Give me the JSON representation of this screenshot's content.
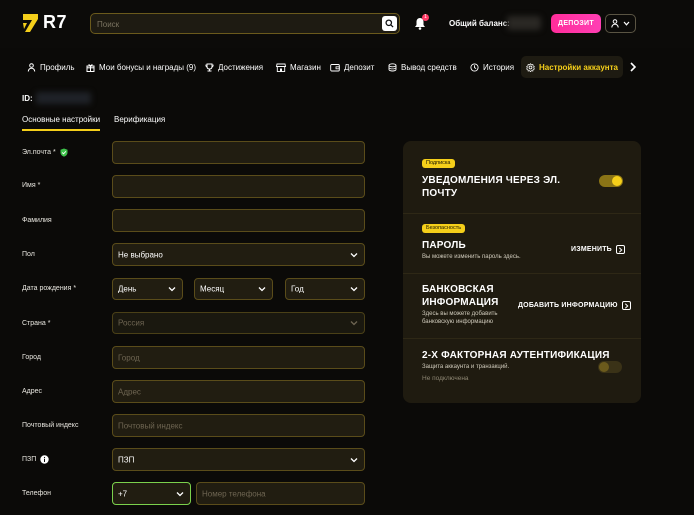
{
  "header": {
    "logo_text": "R7",
    "search_placeholder": "Поиск",
    "notification_count": "1",
    "balance_label": "Общий баланс:",
    "deposit_label": "ДЕПОЗИТ"
  },
  "nav": {
    "items": [
      {
        "label": "Профиль",
        "icon": "user-icon"
      },
      {
        "label": "Мои бонусы и награды (9)",
        "icon": "gift-icon"
      },
      {
        "label": "Достижения",
        "icon": "trophy-icon"
      },
      {
        "label": "Магазин",
        "icon": "store-icon"
      },
      {
        "label": "Депозит",
        "icon": "wallet-icon"
      },
      {
        "label": "Вывод средств",
        "icon": "coins-icon"
      },
      {
        "label": "История",
        "icon": "clock-icon"
      },
      {
        "label": "Настройки аккаунта",
        "icon": "gear-icon",
        "active": true
      }
    ]
  },
  "account": {
    "id_label": "ID:"
  },
  "tabs": {
    "main": "Основные настройки",
    "verification": "Верификация"
  },
  "form": {
    "email_label": "Эл.почта *",
    "first_name_label": "Имя *",
    "last_name_label": "Фамилия",
    "gender_label": "Пол",
    "gender_value": "Не выбрано",
    "birth_label": "Дата рождения *",
    "day_value": "День",
    "month_value": "Месяц",
    "year_value": "Год",
    "country_label": "Страна *",
    "country_value": "Россия",
    "city_label": "Город",
    "city_placeholder": "Город",
    "address_label": "Адрес",
    "address_placeholder": "Адрес",
    "zip_label": "Почтовый индекс",
    "zip_placeholder": "Почтовый индекс",
    "pep_label": "ПЗП",
    "pep_value": "ПЗП",
    "phone_label": "Телефон",
    "phone_code": "+7",
    "phone_placeholder": "Номер телефона"
  },
  "panel": {
    "subscription_badge": "Подписка",
    "email_notif_line1": "УВЕДОМЛЕНИЯ ЧЕРЕЗ ЭЛ.",
    "email_notif_line2": "ПОЧТУ",
    "email_notif_enabled": true,
    "security_badge": "Безопасность",
    "password_title": "ПАРОЛЬ",
    "password_sub": "Вы можете изменить пароль здесь.",
    "password_action": "ИЗМЕНИТЬ",
    "bank_title_line1": "БАНКОВСКАЯ",
    "bank_title_line2": "ИНФОРМАЦИЯ",
    "bank_sub_line1": "Здесь вы можете добавить",
    "bank_sub_line2": "банковскую информацию",
    "bank_action": "ДОБАВИТЬ ИНФОРМАЦИЮ",
    "twofa_title": "2-Х ФАКТОРНАЯ АУТЕНТИФИКАЦИЯ",
    "twofa_sub": "Защита аккаунта и транзакций.",
    "twofa_status": "Не подключена",
    "twofa_enabled": false
  },
  "colors": {
    "accent": "#f5cf1a",
    "deposit": "#ff2d9a",
    "background": "#0b0a08",
    "panel": "#1f1b10",
    "field_border": "#5a4c1a"
  }
}
